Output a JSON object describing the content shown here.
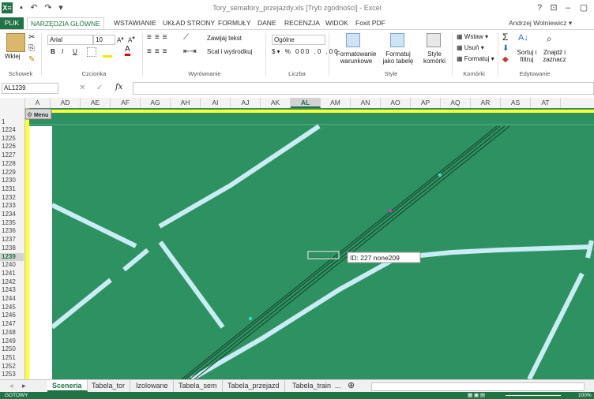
{
  "window": {
    "title": "Tory_semafory_przejazdy.xls [Tryb zgodności] - Excel",
    "app_logo": "X≡",
    "help": "?",
    "ribbon_opts": "⊡",
    "minimize": "–",
    "restore": "▢",
    "user": "Andrzej Wolniewicz ▾"
  },
  "ribbon_tabs": [
    "PLIK",
    "NARZĘDZIA GŁÓWNE",
    "WSTAWIANIE",
    "UKŁAD STRONY",
    "FORMUŁY",
    "DANE",
    "RECENZJA",
    "WIDOK",
    "Foxit PDF"
  ],
  "ribbon": {
    "paste": "Wklej",
    "clipboard_group": "Schowek",
    "font_name": "Arial",
    "font_size": "10",
    "bold": "B",
    "italic": "I",
    "underline": "U",
    "font_group": "Czcionka",
    "wrap_text": "Zawijaj tekst",
    "merge_center": "Scal i wyśrodkuj",
    "align_group": "Wyrównanie",
    "number_format": "Ogólne",
    "number_group": "Liczba",
    "cond_format": "Formatowanie warunkowe",
    "format_table": "Formatuj jako tabelę",
    "cell_styles": "Style komórki",
    "styles_group": "Style",
    "insert": "Wstaw",
    "delete": "Usuń",
    "format": "Formatuj",
    "cells_group": "Komórki",
    "sort_filter": "Sortuj i filtruj",
    "find_select": "Znajdź i zaznacz",
    "editing_group": "Edytowanie"
  },
  "formula_bar": {
    "name_box": "AL1239",
    "fx": "fx",
    "cancel": "✕",
    "enter": "✓",
    "value": ""
  },
  "columns": [
    "A",
    "AD",
    "AE",
    "AF",
    "AG",
    "AH",
    "AI",
    "AJ",
    "AK",
    "AL",
    "AM",
    "AN",
    "AO",
    "AP",
    "AQ",
    "AR",
    "AS",
    "AT"
  ],
  "selected_column": "AL",
  "rows": [
    "1",
    "1224",
    "1225",
    "1226",
    "1227",
    "1228",
    "1229",
    "1230",
    "1231",
    "1232",
    "1233",
    "1234",
    "1235",
    "1236",
    "1237",
    "1238",
    "1239",
    "1240",
    "1241",
    "1242",
    "1243",
    "1244",
    "1245",
    "1246",
    "1247",
    "1248",
    "1249",
    "1250",
    "1251",
    "1252",
    "1253",
    "1254"
  ],
  "selected_row": "1239",
  "menu_button": "Menu",
  "tooltip": "ID: 227 none209",
  "sheets": [
    "Sceneria",
    "Tabela_tor",
    "Izolowane",
    "Tabela_sem",
    "Tabela_przejazd",
    "Tabela_train"
  ],
  "active_sheet": "Sceneria",
  "sheet_more": "...",
  "status": {
    "ready": "GOTOWY",
    "zoom": "100%"
  },
  "colors": {
    "excel_green": "#217346",
    "map_green": "#2e9161",
    "track_light": "#c9ecf5",
    "yellow": "#ffff33"
  }
}
